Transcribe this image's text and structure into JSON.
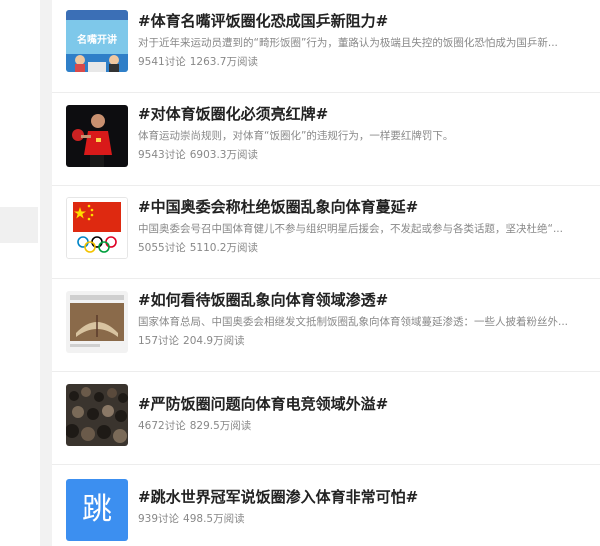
{
  "topics": [
    {
      "title": "#体育名嘴评饭圈化恐成国乒新阻力#",
      "desc": "对于近年来运动员遭到的“畸形饭圈”行为，董路认为极端且失控的饭圈化恐怕成为国乒新...",
      "discussions": "9541讨论",
      "reads": "1263.7万阅读",
      "thumb_icon": "studio-show-thumbnail",
      "thumb_caption": "名嘴开讲"
    },
    {
      "title": "#对体育饭圈化必须亮红牌#",
      "desc": "体育运动崇尚规则，对体育“饭圈化”的违规行为，一样要红牌罚下。",
      "discussions": "9543讨论",
      "reads": "6903.3万阅读",
      "thumb_icon": "table-tennis-player-thumbnail"
    },
    {
      "title": "#中国奥委会称杜绝饭圈乱象向体育蔓延#",
      "desc": "中国奥委会号召中国体育健儿不参与组织明星后援会，不发起或参与各类话题，坚决杜绝“...",
      "discussions": "5055讨论",
      "reads": "5110.2万阅读",
      "thumb_icon": "flag-and-olympic-rings-thumbnail"
    },
    {
      "title": "#如何看待饭圈乱象向体育领域渗透#",
      "desc": "国家体育总局、中国奥委会相继发文抵制饭圈乱象向体育领域蔓延渗透：一些人披着粉丝外...",
      "discussions": "157讨论",
      "reads": "204.9万阅读",
      "thumb_icon": "book-thumbnail"
    },
    {
      "title": "#严防饭圈问题向体育电竞领域外溢#",
      "desc": "",
      "discussions": "4672讨论",
      "reads": "829.5万阅读",
      "thumb_icon": "crowd-thumbnail"
    },
    {
      "title": "#跳水世界冠军说饭圈渗入体育非常可怕#",
      "desc": "",
      "discussions": "939讨论",
      "reads": "498.5万阅读",
      "thumb_icon": "tiao-character-thumbnail",
      "thumb_char": "跳"
    }
  ],
  "colors": {
    "accent_blue": "#3c8ff0",
    "flag_red": "#de2910",
    "flag_yellow": "#ffde00"
  }
}
